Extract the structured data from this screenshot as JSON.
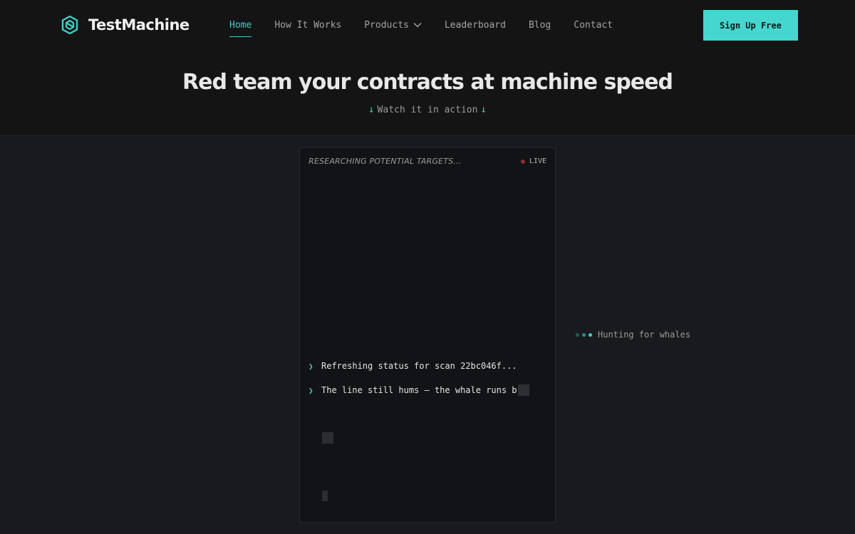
{
  "brand": {
    "name": "TestMachine",
    "accent": "#3ccfc7"
  },
  "nav": {
    "items": [
      {
        "label": "Home",
        "active": true
      },
      {
        "label": "How It Works"
      },
      {
        "label": "Products",
        "icon": "chevron-down-icon"
      },
      {
        "label": "Leaderboard"
      },
      {
        "label": "Blog"
      },
      {
        "label": "Contact"
      }
    ],
    "cta": "Sign Up Free"
  },
  "hero": {
    "title": "Red team your contracts at machine speed",
    "subtitle": "Watch it in action",
    "arrow": "↓"
  },
  "terminal": {
    "status": "RESEARCHING POTENTIAL TARGETS...",
    "live": "LIVE",
    "prompt": "❯",
    "lines": [
      "Refreshing status for scan 22bc046f...",
      "The line still hums — the whale runs b"
    ]
  },
  "side_status": {
    "text": "Hunting for whales"
  }
}
